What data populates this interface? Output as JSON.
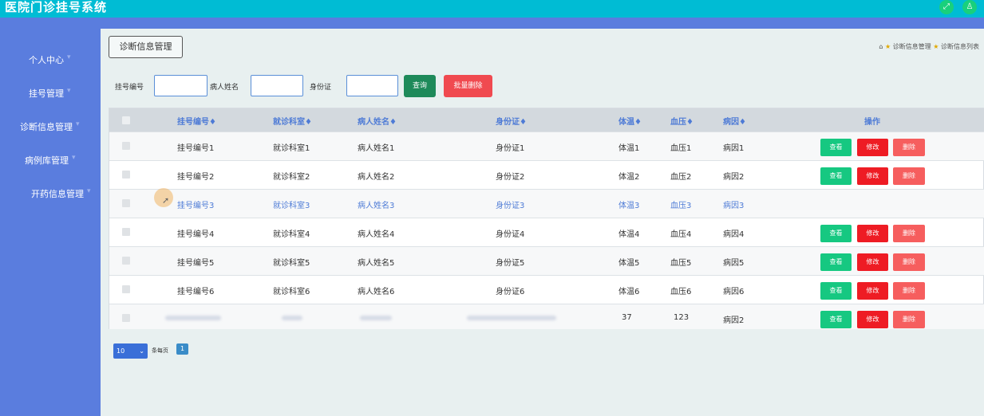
{
  "app": {
    "title": "医院门诊挂号系统",
    "icon_left": "expand-icon",
    "icon_right": "user-icon"
  },
  "sidebar": {
    "items": [
      {
        "label": "个人中心"
      },
      {
        "label": "挂号管理"
      },
      {
        "label": "诊断信息管理"
      },
      {
        "label": "病例库管理"
      },
      {
        "label": "开药信息管理"
      }
    ]
  },
  "page": {
    "tag_title": "诊断信息管理",
    "breadcrumb": {
      "level1": "诊断信息管理",
      "level2": "诊断信息列表"
    }
  },
  "search": {
    "reg_no_label": "挂号编号",
    "patient_label": "病人姓名",
    "id_label": "身份证",
    "query_label": "查询",
    "batch_delete_label": "批量删除"
  },
  "table": {
    "columns": [
      "挂号编号",
      "就诊科室",
      "病人姓名",
      "身份证",
      "体温",
      "血压",
      "病因",
      "操作"
    ],
    "sort_mark": "♦",
    "rows": [
      {
        "reg_no": "挂号编号1",
        "dept": "就诊科室1",
        "name": "病人姓名1",
        "id_card": "身份证1",
        "temp": "体温1",
        "bp": "血压1",
        "cause": "病因1"
      },
      {
        "reg_no": "挂号编号2",
        "dept": "就诊科室2",
        "name": "病人姓名2",
        "id_card": "身份证2",
        "temp": "体温2",
        "bp": "血压2",
        "cause": "病因2"
      },
      {
        "reg_no": "挂号编号3",
        "dept": "就诊科室3",
        "name": "病人姓名3",
        "id_card": "身份证3",
        "temp": "体温3",
        "bp": "血压3",
        "cause": "病因3"
      },
      {
        "reg_no": "挂号编号4",
        "dept": "就诊科室4",
        "name": "病人姓名4",
        "id_card": "身份证4",
        "temp": "体温4",
        "bp": "血压4",
        "cause": "病因4"
      },
      {
        "reg_no": "挂号编号5",
        "dept": "就诊科室5",
        "name": "病人姓名5",
        "id_card": "身份证5",
        "temp": "体温5",
        "bp": "血压5",
        "cause": "病因5"
      },
      {
        "reg_no": "挂号编号6",
        "dept": "就诊科室6",
        "name": "病人姓名6",
        "id_card": "身份证6",
        "temp": "体温6",
        "bp": "血压6",
        "cause": "病因6"
      },
      {
        "reg_no": "",
        "dept": "",
        "name": "",
        "id_card": "",
        "temp": "37",
        "bp": "123",
        "cause": "病因2"
      }
    ],
    "actions": {
      "view": "查看",
      "edit": "修改",
      "delete": "删除"
    }
  },
  "pager": {
    "page_size": "10",
    "per_page_label": "条每页",
    "current_page": "1"
  },
  "colors": {
    "topbar": "#00bcd4",
    "sidebar": "#5a7dde",
    "header_text": "#4e7bd6",
    "view": "#16c881",
    "edit": "#ee1c24",
    "delete": "#f65e5e"
  }
}
